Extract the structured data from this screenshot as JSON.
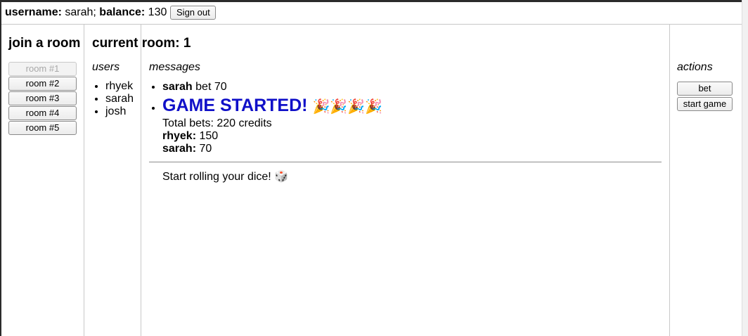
{
  "header": {
    "username_label": "username:",
    "username": "sarah;",
    "balance_label": "balance:",
    "balance": "130",
    "sign_out_label": "Sign out"
  },
  "join": {
    "title": "join a room",
    "rooms": [
      "room #1",
      "room #2",
      "room #3",
      "room #4",
      "room #5"
    ]
  },
  "current_room": {
    "title": "current room: 1"
  },
  "users": {
    "title": "users",
    "list": [
      "rhyek",
      "sarah",
      "josh"
    ]
  },
  "messages": {
    "title": "messages",
    "bet_user": "sarah",
    "bet_text": "bet 70",
    "game_started": "GAME STARTED!",
    "party_icons": "🎉🎉🎉🎉",
    "total_bets": "Total bets: 220 credits",
    "bets": [
      {
        "user": "rhyek:",
        "amount": "150"
      },
      {
        "user": "sarah:",
        "amount": "70"
      }
    ],
    "roll_text": "Start rolling your dice!",
    "dice_icon": "🎲"
  },
  "actions": {
    "title": "actions",
    "bet_label": "bet",
    "start_game_label": "start game"
  }
}
